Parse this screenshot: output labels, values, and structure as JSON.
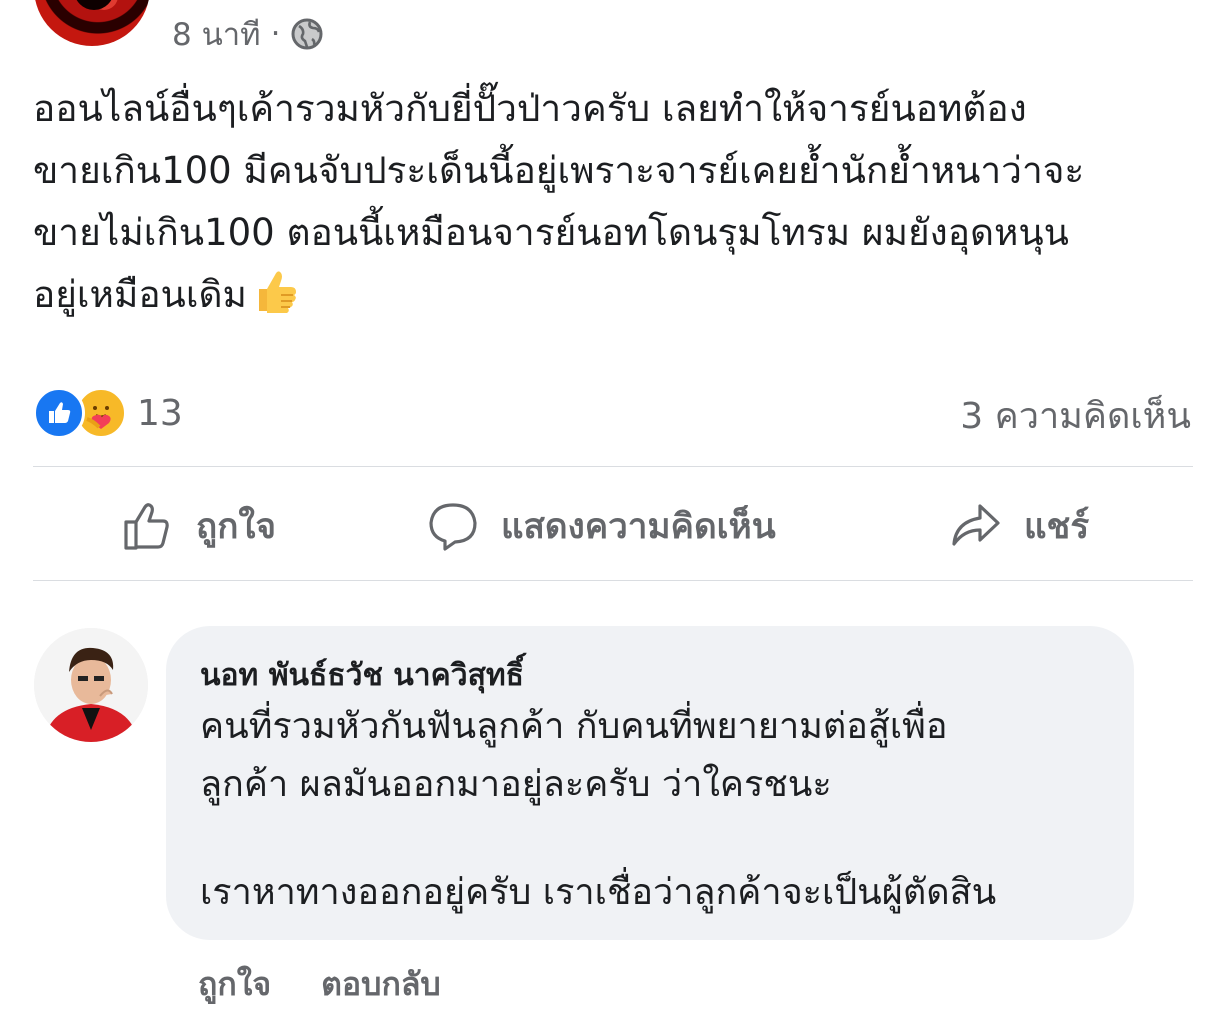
{
  "post": {
    "time": "8 นาที",
    "separator": "·",
    "privacy_icon": "globe-icon",
    "text_lines": [
      "ออนไลน์อื่นๆเค้ารวมหัวกับยี่ปั๊วป่าวครับ เลยทำให้จารย์นอทต้อง",
      "ขายเกิน100 มีคนจับประเด็นนี้อยู่เพราะจารย์เคยย้ำนักย้ำหนาว่าจะ",
      "ขายไม่เกิน100 ตอนนี้เหมือนจารย์นอทโดนรุมโทรม ผมยังอุดหนุน",
      "อยู่เหมือนเดิม"
    ],
    "text_emoji": "thumbs-up-emoji"
  },
  "reactions": {
    "icons": [
      "like-reaction-icon",
      "care-reaction-icon"
    ],
    "count": "13",
    "comments_label": "3 ความคิดเห็น"
  },
  "actions": {
    "like": "ถูกใจ",
    "comment": "แสดงความคิดเห็น",
    "share": "แชร์"
  },
  "comment": {
    "author": "นอท พันธ์ธวัช นาควิสุทธิ์",
    "lines": [
      "คนที่รวมหัวกันฟันลูกค้า กับคนที่พยายามต่อสู้เพื่อ",
      "ลูกค้า ผลมันออกมาอยู่ละครับ ว่าใครชนะ",
      "เราหาทางออกอยู่ครับ เราเชื่อว่าลูกค้าจะเป็นผู้ตัดสิน"
    ],
    "like_label": "ถูกใจ",
    "reply_label": "ตอบกลับ"
  },
  "colors": {
    "secondary_text": "#65676b",
    "primary_text": "#1c1e21",
    "like_blue": "#1877f2",
    "bubble_bg": "#f0f2f5",
    "divider": "#dadde1"
  }
}
